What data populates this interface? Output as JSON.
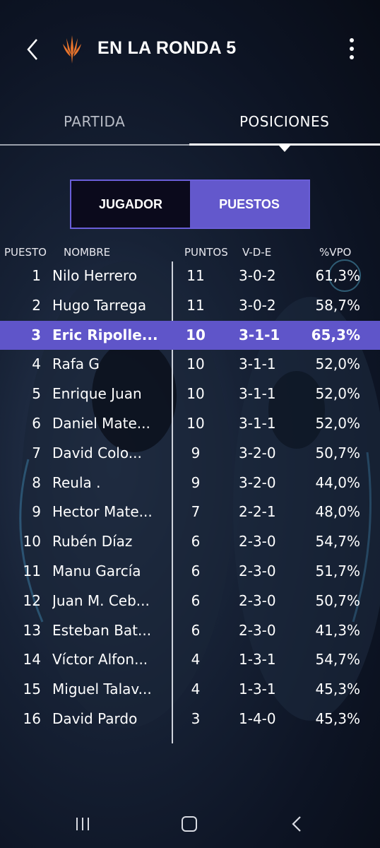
{
  "header": {
    "title": "EN LA RONDA 5",
    "logo": "planeswalker-flame-logo"
  },
  "tabs": [
    {
      "label": "PARTIDA",
      "active": false
    },
    {
      "label": "POSICIONES",
      "active": true
    }
  ],
  "toggle": {
    "left": "JUGADOR",
    "right": "PUESTOS",
    "selected": "PUESTOS"
  },
  "table": {
    "columns": [
      "PUESTO",
      "NOMBRE",
      "PUNTOS",
      "V-D-E",
      "%VPO"
    ],
    "highlighted_rank": "3",
    "rows": [
      {
        "rank": "1",
        "name": "Nilo Herrero",
        "points": "11",
        "record": "3-0-2",
        "vpo": "61,3%"
      },
      {
        "rank": "2",
        "name": "Hugo  Tarrega",
        "points": "11",
        "record": "3-0-2",
        "vpo": "58,7%"
      },
      {
        "rank": "3",
        "name": "Eric Ripolle...",
        "points": "10",
        "record": "3-1-1",
        "vpo": "65,3%"
      },
      {
        "rank": "4",
        "name": "Rafa G",
        "points": "10",
        "record": "3-1-1",
        "vpo": "52,0%"
      },
      {
        "rank": "5",
        "name": "Enrique Juan",
        "points": "10",
        "record": "3-1-1",
        "vpo": "52,0%"
      },
      {
        "rank": "6",
        "name": "Daniel Mate...",
        "points": "10",
        "record": "3-1-1",
        "vpo": "52,0%"
      },
      {
        "rank": "7",
        "name": "David Colo...",
        "points": "9",
        "record": "3-2-0",
        "vpo": "50,7%"
      },
      {
        "rank": "8",
        "name": "Reula .",
        "points": "9",
        "record": "3-2-0",
        "vpo": "44,0%"
      },
      {
        "rank": "9",
        "name": "Hector Mate...",
        "points": "7",
        "record": "2-2-1",
        "vpo": "48,0%"
      },
      {
        "rank": "10",
        "name": "Rubén Díaz",
        "points": "6",
        "record": "2-3-0",
        "vpo": "54,7%"
      },
      {
        "rank": "11",
        "name": "Manu García",
        "points": "6",
        "record": "2-3-0",
        "vpo": "51,7%"
      },
      {
        "rank": "12",
        "name": "Juan M. Ceb...",
        "points": "6",
        "record": "2-3-0",
        "vpo": "50,7%"
      },
      {
        "rank": "13",
        "name": "Esteban Bat...",
        "points": "6",
        "record": "2-3-0",
        "vpo": "41,3%"
      },
      {
        "rank": "14",
        "name": "Víctor  Alfon...",
        "points": "4",
        "record": "1-3-1",
        "vpo": "54,7%"
      },
      {
        "rank": "15",
        "name": "Miguel Talav...",
        "points": "4",
        "record": "1-3-1",
        "vpo": "45,3%"
      },
      {
        "rank": "16",
        "name": "David Pardo",
        "points": "3",
        "record": "1-4-0",
        "vpo": "45,3%"
      }
    ]
  },
  "colors": {
    "accent": "#6358cc",
    "highlight_row": "#5f55c9",
    "logo": "#e8742c"
  },
  "navbar": {
    "icons": [
      "recent-apps-icon",
      "home-icon",
      "back-icon"
    ]
  }
}
